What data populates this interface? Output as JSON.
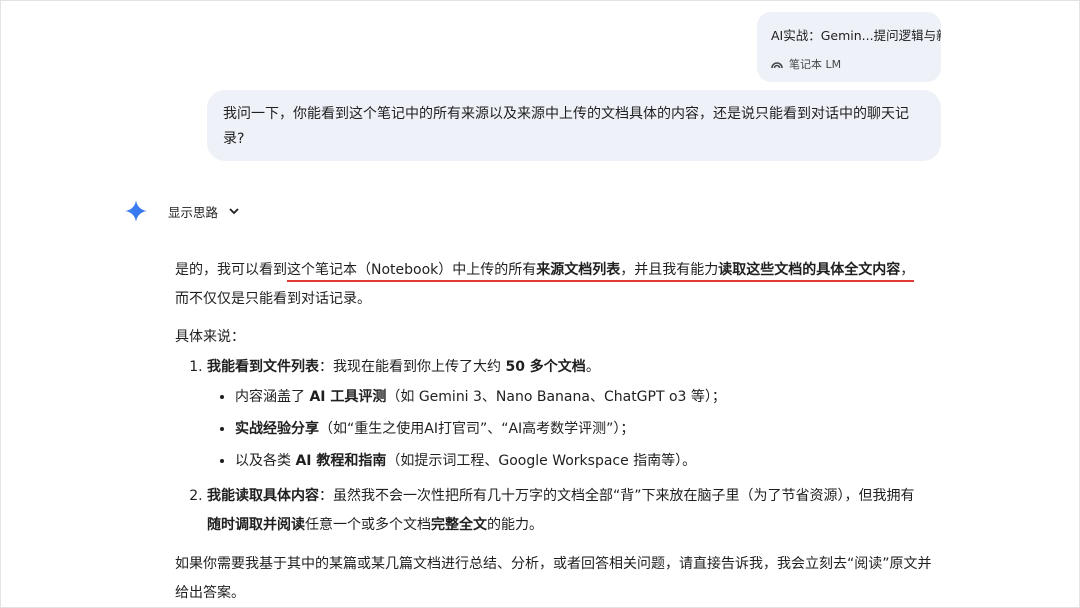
{
  "source_chip": {
    "title": "AI实战：Gemin...提问逻辑与新",
    "subtitle": "笔记本 LM"
  },
  "user_message": "我问一下，你能看到这个笔记中的所有来源以及来源中上传的文档具体的内容，还是说只能看到对话中的聊天记录?",
  "thinking": {
    "label": "显示思路"
  },
  "answer": {
    "p1": {
      "a": "是的，我可以看到",
      "u1": "这个笔记本（Notebook）中上传的所有",
      "u1b": "来源文档列表",
      "u1c": "，并且我有能力",
      "u1d": "读取这些文档的具体全文内容",
      "u1e": "，",
      "tail": "而不仅仅是只能看到对话记录。"
    },
    "p2": "具体来说：",
    "item1": {
      "bold": "我能看到文件列表",
      "text": "：我现在能看到你上传了大约 ",
      "bold2": "50 多个文档",
      "end": "。",
      "subs": [
        {
          "pre": "内容涵盖了 ",
          "bold": "AI 工具评测",
          "post": "（如 Gemini 3、Nano Banana、ChatGPT o3 等）；"
        },
        {
          "pre": "",
          "bold": "实战经验分享",
          "post": "（如“重生之使用AI打官司”、“AI高考数学评测”）；"
        },
        {
          "pre": "以及各类 ",
          "bold": "AI 教程和指南",
          "post": "（如提示词工程、Google Workspace 指南等）。"
        }
      ]
    },
    "item2": {
      "bold": "我能读取具体内容",
      "text": "：虽然我不会一次性把所有几十万字的文档全部“背”下来放在脑子里（为了节省资源），",
      "u_text": "但我拥有",
      "u_bold": "随时调取并阅读",
      "u_text2": "任意一个或多个文档",
      "u_bold2": "完整全文",
      "u_text3": "的能力。"
    },
    "p3": "如果你需要我基于其中的某篇或某几篇文档进行总结、分析，或者回答相关问题，请直接告诉我，我会立刻去“阅读”原文并给出答案。"
  }
}
